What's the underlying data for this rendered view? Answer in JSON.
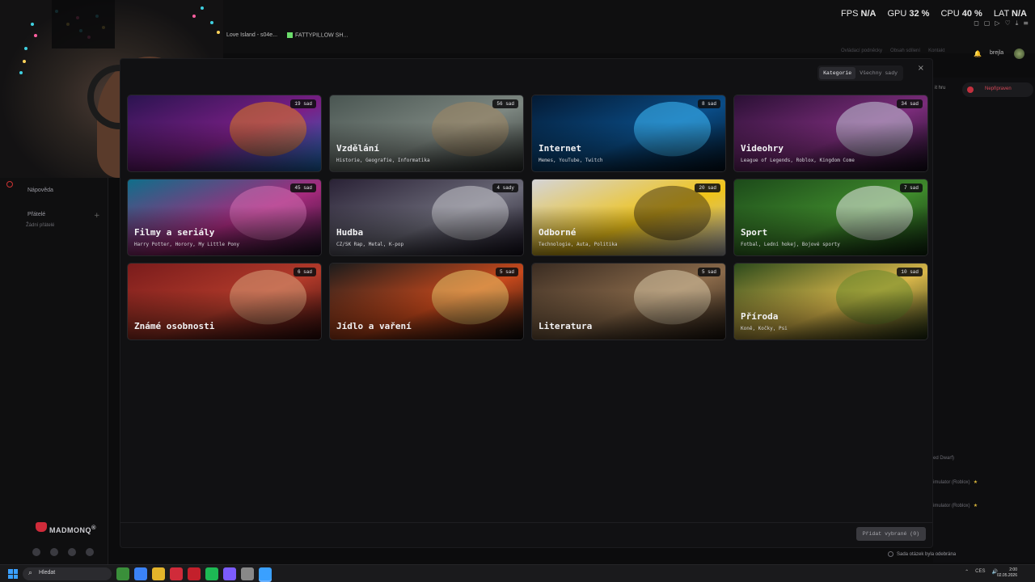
{
  "overlay": {
    "fps_label": "FPS",
    "fps_value": "N/A",
    "gpu_label": "GPU",
    "gpu_value": "32 %",
    "cpu_label": "CPU",
    "cpu_value": "40 %",
    "lat_label": "LAT",
    "lat_value": "N/A"
  },
  "bookmarks": [
    "Love Island - s04e...",
    "FATTYPILLOW SH..."
  ],
  "sidebar": {
    "help": "Nápověda",
    "friends": "Přátelé",
    "no_friends": "Žádní přátelé",
    "brand": "MADMONQ",
    "brand_mark": "®"
  },
  "header": {
    "links": [
      "Ovládací podněcky",
      "Obsah sdílení",
      "Kontakt"
    ],
    "username": "brejla"
  },
  "right_panel": {
    "join_label": "it hru",
    "toggle_label": "Nepřipraven",
    "lines": [
      "ed Dwarf)",
      "imulator (Roblox)",
      "imulator (Roblox)"
    ]
  },
  "modal": {
    "tabs": [
      "Kategorie",
      "Všechny sady"
    ],
    "active_tab": "Kategorie",
    "close": "×",
    "add_button": "Přidat vybrané (0)",
    "categories": [
      {
        "title": "",
        "subtitle": "",
        "badge": "19 sad",
        "palette": [
          "#2b1450",
          "#7a1f86",
          "#e07b1f",
          "#1d78c9"
        ]
      },
      {
        "title": "Vzdělání",
        "subtitle": "Historie, Geografie, Informatika",
        "badge": "56 sad",
        "palette": [
          "#4a5652",
          "#7d8781",
          "#a08662",
          "#2b2f2d"
        ]
      },
      {
        "title": "Internet",
        "subtitle": "Memes, YouTube, Twitch",
        "badge": "8 sad",
        "palette": [
          "#041a33",
          "#0a4c86",
          "#3fc0ff",
          "#02101e"
        ]
      },
      {
        "title": "Videohry",
        "subtitle": "League of Legends, Roblox, Kingdom Come",
        "badge": "34 sad",
        "palette": [
          "#2a1034",
          "#7a2c7a",
          "#c5c8d8",
          "#120a1a"
        ]
      },
      {
        "title": "Filmy a seriály",
        "subtitle": "Harry Potter, Horory, My Little Pony",
        "badge": "45 sad",
        "palette": [
          "#0f6e8a",
          "#a62a7d",
          "#d06fb0",
          "#1a1024"
        ]
      },
      {
        "title": "Hudba",
        "subtitle": "CZ/SK Rap, Metal, K-pop",
        "badge": "4 sady",
        "palette": [
          "#2a2236",
          "#6b6a78",
          "#c7c7cc",
          "#140f1e"
        ]
      },
      {
        "title": "Odborné",
        "subtitle": "Technologie, Auta, Politika",
        "badge": "20 sad",
        "palette": [
          "#d4d4d8",
          "#f0c419",
          "#4a3a12",
          "#b8b8bc"
        ]
      },
      {
        "title": "Sport",
        "subtitle": "Fotbal, Lední hokej, Bojové sporty",
        "badge": "7 sad",
        "palette": [
          "#1c4a1a",
          "#3f8a2c",
          "#e9e9e9",
          "#0c240c"
        ]
      },
      {
        "title": "Známé osobnosti",
        "subtitle": "",
        "badge": "6 sad",
        "palette": [
          "#7a1c1c",
          "#b23a2a",
          "#d8a07a",
          "#2a0a0a"
        ]
      },
      {
        "title": "Jídlo a vaření",
        "subtitle": "",
        "badge": "5 sad",
        "palette": [
          "#1c1c1c",
          "#c8491c",
          "#e8c46a",
          "#0a0a0a"
        ]
      },
      {
        "title": "Literatura",
        "subtitle": "",
        "badge": "5 sad",
        "palette": [
          "#3a2c22",
          "#8a6a4a",
          "#d8c8a8",
          "#1c140e"
        ]
      },
      {
        "title": "Příroda",
        "subtitle": "Koně, Kočky, Psi",
        "badge": "10 sad",
        "palette": [
          "#2c4a1c",
          "#d8b64a",
          "#6a8a2c",
          "#1a2a10"
        ]
      }
    ]
  },
  "toast": "Sada otázek byla odebrána",
  "taskbar": {
    "search": "Hledat",
    "lang": "CES",
    "time": "2:00",
    "date": "02.05.2026",
    "apps": [
      "#3a8f3a",
      "#3b82f6",
      "#e4b42a",
      "#d02b3a",
      "#c3202b",
      "#1db954",
      "#7c5cff",
      "#888888",
      "#3aa0ff"
    ]
  },
  "colors": {
    "accent": "#d02b3a",
    "modal_bg": "#111113",
    "page_bg": "#0c0c0d"
  }
}
